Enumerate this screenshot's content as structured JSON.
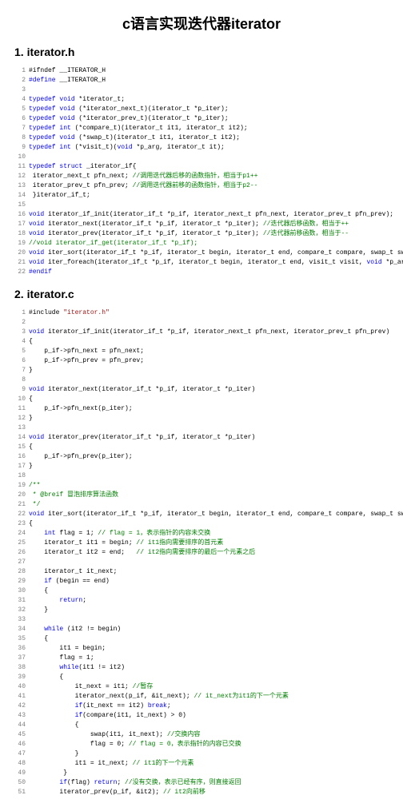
{
  "title": "c语言实现迭代器iterator",
  "sections": {
    "h1": "1. iterator.h",
    "h2": "2. iterator.c"
  },
  "code_h": [
    [
      {
        "c": "tx",
        "t": "#ifndef __ITERATOR_H"
      }
    ],
    [
      {
        "c": "pp",
        "t": "#define"
      },
      {
        "c": "tx",
        "t": " __ITERATOR_H"
      }
    ],
    [],
    [
      {
        "c": "kw",
        "t": "typedef"
      },
      {
        "c": "tx",
        "t": " "
      },
      {
        "c": "kw",
        "t": "void"
      },
      {
        "c": "tx",
        "t": " *iterator_t;"
      }
    ],
    [
      {
        "c": "kw",
        "t": "typedef"
      },
      {
        "c": "tx",
        "t": " "
      },
      {
        "c": "kw",
        "t": "void"
      },
      {
        "c": "tx",
        "t": " (*iterator_next_t)(iterator_t *p_iter);"
      }
    ],
    [
      {
        "c": "kw",
        "t": "typedef"
      },
      {
        "c": "tx",
        "t": " "
      },
      {
        "c": "kw",
        "t": "void"
      },
      {
        "c": "tx",
        "t": " (*iterator_prev_t)(iterator_t *p_iter);"
      }
    ],
    [
      {
        "c": "kw",
        "t": "typedef"
      },
      {
        "c": "tx",
        "t": " "
      },
      {
        "c": "kw",
        "t": "int"
      },
      {
        "c": "tx",
        "t": " (*compare_t)(iterator_t it1, iterator_t it2);"
      }
    ],
    [
      {
        "c": "kw",
        "t": "typedef"
      },
      {
        "c": "tx",
        "t": " "
      },
      {
        "c": "kw",
        "t": "void"
      },
      {
        "c": "tx",
        "t": " (*swap_t)(iterator_t it1, iterator_t it2);"
      }
    ],
    [
      {
        "c": "kw",
        "t": "typedef"
      },
      {
        "c": "tx",
        "t": " "
      },
      {
        "c": "kw",
        "t": "int"
      },
      {
        "c": "tx",
        "t": " (*visit_t)("
      },
      {
        "c": "kw",
        "t": "void"
      },
      {
        "c": "tx",
        "t": " *p_arg, iterator_t it);"
      }
    ],
    [],
    [
      {
        "c": "kw",
        "t": "typedef"
      },
      {
        "c": "tx",
        "t": " "
      },
      {
        "c": "kw",
        "t": "struct"
      },
      {
        "c": "tx",
        "t": " _iterator_if{"
      }
    ],
    [
      {
        "c": "tx",
        "t": " iterator_next_t pfn_next; "
      },
      {
        "c": "cm",
        "t": "//调用迭代器后移的函数指针，相当于p1++"
      }
    ],
    [
      {
        "c": "tx",
        "t": " iterator_prev_t pfn_prev; "
      },
      {
        "c": "cm",
        "t": "//调用迭代器前移的函数指针，相当于p2--"
      }
    ],
    [
      {
        "c": "tx",
        "t": " }iterator_if_t;"
      }
    ],
    [],
    [
      {
        "c": "kw",
        "t": "void"
      },
      {
        "c": "tx",
        "t": " iterator_if_init(iterator_if_t *p_if, iterator_next_t pfn_next, iterator_prev_t pfn_prev);"
      }
    ],
    [
      {
        "c": "kw",
        "t": "void"
      },
      {
        "c": "tx",
        "t": " iterator_next(iterator_if_t *p_if, iterator_t *p_iter); "
      },
      {
        "c": "cm",
        "t": "//迭代器后移函数，相当于++"
      }
    ],
    [
      {
        "c": "kw",
        "t": "void"
      },
      {
        "c": "tx",
        "t": " iterator_prev(iterator_if_t *p_if, iterator_t *p_iter); "
      },
      {
        "c": "cm",
        "t": "//迭代器前移函数，相当于--"
      }
    ],
    [
      {
        "c": "cm",
        "t": "//void iterator_if_get(iterator_if_t *p_if);"
      }
    ],
    [
      {
        "c": "kw",
        "t": "void"
      },
      {
        "c": "tx",
        "t": " iter_sort(iterator_if_t *p_if, iterator_t begin, iterator_t end, compare_t compare, swap_t swap);"
      }
    ],
    [
      {
        "c": "kw",
        "t": "void"
      },
      {
        "c": "tx",
        "t": " iter_foreach(iterator_if_t *p_if, iterator_t begin, iterator_t end, visit_t visit, "
      },
      {
        "c": "kw",
        "t": "void"
      },
      {
        "c": "tx",
        "t": " *p_arg);"
      }
    ],
    [
      {
        "c": "pp",
        "t": "#endif"
      }
    ]
  ],
  "code_c": [
    [
      {
        "c": "tx",
        "t": "#include "
      },
      {
        "c": "st",
        "t": "\"iterator.h\""
      }
    ],
    [],
    [
      {
        "c": "kw",
        "t": "void"
      },
      {
        "c": "tx",
        "t": " iterator_if_init(iterator_if_t *p_if, iterator_next_t pfn_next, iterator_prev_t pfn_prev)"
      }
    ],
    [
      {
        "c": "tx",
        "t": "{"
      }
    ],
    [
      {
        "c": "tx",
        "t": "    p_if->pfn_next = pfn_next;"
      }
    ],
    [
      {
        "c": "tx",
        "t": "    p_if->pfn_prev = pfn_prev;"
      }
    ],
    [
      {
        "c": "tx",
        "t": "}"
      }
    ],
    [],
    [
      {
        "c": "kw",
        "t": "void"
      },
      {
        "c": "tx",
        "t": " iterator_next(iterator_if_t *p_if, iterator_t *p_iter)"
      }
    ],
    [
      {
        "c": "tx",
        "t": "{"
      }
    ],
    [
      {
        "c": "tx",
        "t": "    p_if->pfn_next(p_iter);"
      }
    ],
    [
      {
        "c": "tx",
        "t": "}"
      }
    ],
    [],
    [
      {
        "c": "kw",
        "t": "void"
      },
      {
        "c": "tx",
        "t": " iterator_prev(iterator_if_t *p_if, iterator_t *p_iter)"
      }
    ],
    [
      {
        "c": "tx",
        "t": "{"
      }
    ],
    [
      {
        "c": "tx",
        "t": "    p_if->pfn_prev(p_iter);"
      }
    ],
    [
      {
        "c": "tx",
        "t": "}"
      }
    ],
    [],
    [
      {
        "c": "cm",
        "t": "/**"
      }
    ],
    [
      {
        "c": "cm",
        "t": " * @breif 冒泡排序算法函数"
      }
    ],
    [
      {
        "c": "cm",
        "t": " */"
      }
    ],
    [
      {
        "c": "kw",
        "t": "void"
      },
      {
        "c": "tx",
        "t": " iter_sort(iterator_if_t *p_if, iterator_t begin, iterator_t end, compare_t compare, swap_t swap)"
      }
    ],
    [
      {
        "c": "tx",
        "t": "{"
      }
    ],
    [
      {
        "c": "tx",
        "t": "    "
      },
      {
        "c": "kw",
        "t": "int"
      },
      {
        "c": "tx",
        "t": " flag = 1; "
      },
      {
        "c": "cm",
        "t": "// flag = 1，表示指针的内容未交换"
      }
    ],
    [
      {
        "c": "tx",
        "t": "    iterator_t it1 = begin; "
      },
      {
        "c": "cm",
        "t": "// it1指向需要排序的首元素"
      }
    ],
    [
      {
        "c": "tx",
        "t": "    iterator_t it2 = end;   "
      },
      {
        "c": "cm",
        "t": "// it2指向需要排序的最后一个元素之后"
      }
    ],
    [],
    [
      {
        "c": "tx",
        "t": "    iterator_t it_next;"
      }
    ],
    [
      {
        "c": "tx",
        "t": "    "
      },
      {
        "c": "kw",
        "t": "if"
      },
      {
        "c": "tx",
        "t": " (begin == end)"
      }
    ],
    [
      {
        "c": "tx",
        "t": "    {"
      }
    ],
    [
      {
        "c": "tx",
        "t": "        "
      },
      {
        "c": "kw",
        "t": "return"
      },
      {
        "c": "tx",
        "t": ";"
      }
    ],
    [
      {
        "c": "tx",
        "t": "    }"
      }
    ],
    [],
    [
      {
        "c": "tx",
        "t": "    "
      },
      {
        "c": "kw",
        "t": "while"
      },
      {
        "c": "tx",
        "t": " (it2 != begin)"
      }
    ],
    [
      {
        "c": "tx",
        "t": "    {"
      }
    ],
    [
      {
        "c": "tx",
        "t": "        it1 = begin;"
      }
    ],
    [
      {
        "c": "tx",
        "t": "        flag = 1;"
      }
    ],
    [
      {
        "c": "tx",
        "t": "        "
      },
      {
        "c": "kw",
        "t": "while"
      },
      {
        "c": "tx",
        "t": "(it1 != it2)"
      }
    ],
    [
      {
        "c": "tx",
        "t": "        {"
      }
    ],
    [
      {
        "c": "tx",
        "t": "            it_next = it1; "
      },
      {
        "c": "cm",
        "t": "//暂存"
      }
    ],
    [
      {
        "c": "tx",
        "t": "            iterator_next(p_if, &it_next); "
      },
      {
        "c": "cm",
        "t": "// it_next为it1的下一个元素"
      }
    ],
    [
      {
        "c": "tx",
        "t": "            "
      },
      {
        "c": "kw",
        "t": "if"
      },
      {
        "c": "tx",
        "t": "(it_next == it2) "
      },
      {
        "c": "kw",
        "t": "break"
      },
      {
        "c": "tx",
        "t": ";"
      }
    ],
    [
      {
        "c": "tx",
        "t": "            "
      },
      {
        "c": "kw",
        "t": "if"
      },
      {
        "c": "tx",
        "t": "(compare(it1, it_next) > 0)"
      }
    ],
    [
      {
        "c": "tx",
        "t": "            {"
      }
    ],
    [
      {
        "c": "tx",
        "t": "                swap(it1, it_next); "
      },
      {
        "c": "cm",
        "t": "//交换内容"
      }
    ],
    [
      {
        "c": "tx",
        "t": "                flag = 0; "
      },
      {
        "c": "cm",
        "t": "// flag = 0，表示指针的内容已交换"
      }
    ],
    [
      {
        "c": "tx",
        "t": "            }"
      }
    ],
    [
      {
        "c": "tx",
        "t": "            it1 = it_next; "
      },
      {
        "c": "cm",
        "t": "// it1的下一个元素"
      }
    ],
    [
      {
        "c": "tx",
        "t": "         }"
      }
    ],
    [
      {
        "c": "tx",
        "t": "        "
      },
      {
        "c": "kw",
        "t": "if"
      },
      {
        "c": "tx",
        "t": "(flag) "
      },
      {
        "c": "kw",
        "t": "return"
      },
      {
        "c": "tx",
        "t": "; "
      },
      {
        "c": "cm",
        "t": "//没有交换，表示已经有序，则直接返回"
      }
    ],
    [
      {
        "c": "tx",
        "t": "        iterator_prev(p_if, &it2); "
      },
      {
        "c": "cm",
        "t": "// it2向前移"
      }
    ]
  ]
}
